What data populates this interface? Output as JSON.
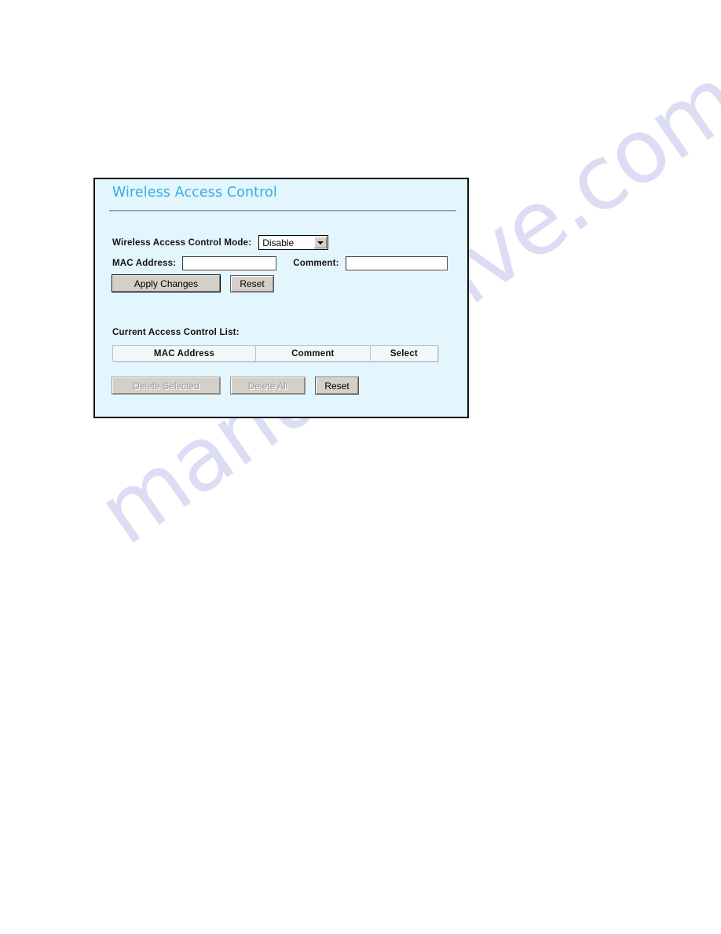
{
  "watermark": {
    "text": "manualshive.com"
  },
  "panel": {
    "title": "Wireless Access Control",
    "mode_row": {
      "label": "Wireless Access Control Mode:",
      "select_value": "Disable",
      "select_options": [
        "Disable"
      ],
      "arrow_icon": "chevron-down-icon"
    },
    "mac_row": {
      "mac_label": "MAC Address:",
      "mac_value": "",
      "comment_label": "Comment:",
      "comment_value": ""
    },
    "action_buttons": {
      "apply_label": "Apply Changes",
      "reset_label": "Reset"
    },
    "list": {
      "label": "Current Access Control List:",
      "columns": [
        "MAC Address",
        "Comment",
        "Select"
      ],
      "rows": []
    },
    "list_buttons": {
      "delete_selected_label": "Delete Selected",
      "delete_all_label": "Delete All",
      "reset_label": "Reset"
    }
  },
  "colors": {
    "panel_background": "#e3f5fd",
    "panel_border": "#111111",
    "title_text": "#36ace3",
    "button_face": "#d4d0c8",
    "watermark": "#c8c8ee"
  }
}
